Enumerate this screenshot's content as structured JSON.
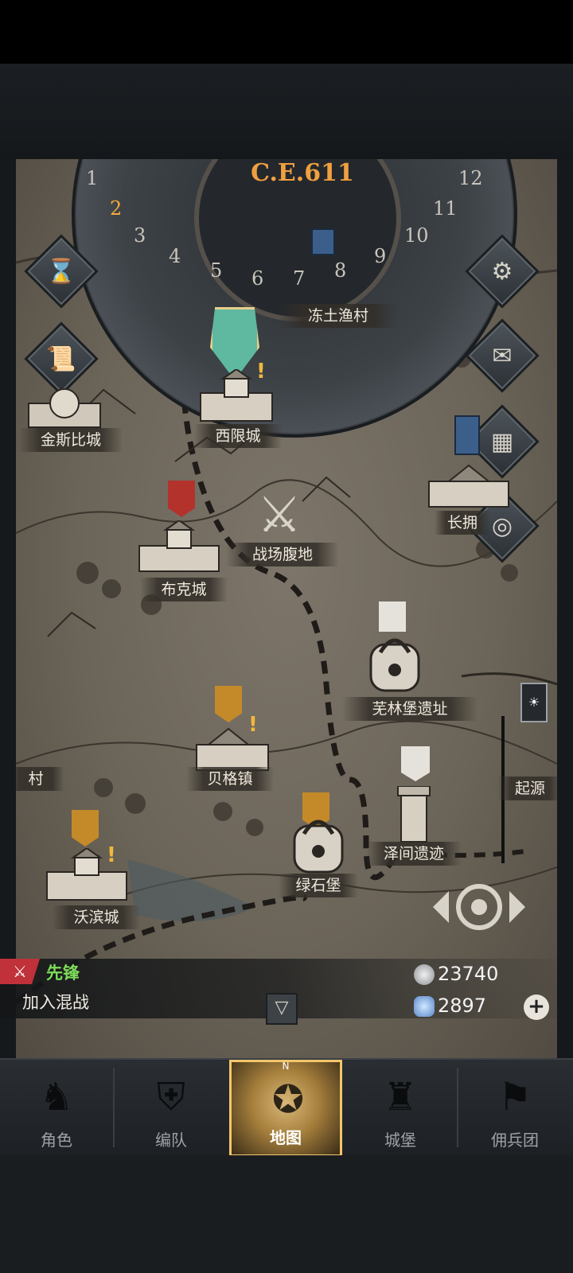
{
  "calendar": {
    "era": "C.E.611",
    "months": [
      "1",
      "2",
      "3",
      "4",
      "5",
      "6",
      "7",
      "8",
      "9",
      "10",
      "11",
      "12"
    ],
    "active_month": "2"
  },
  "locations": {
    "frozen_village": "冻土渔村",
    "xixian": "西限城",
    "jinsibi": "金斯比城",
    "changyong": "长拥",
    "battlefield": "战场腹地",
    "buke": "布克城",
    "wulin_ruins": "芜林堡遗址",
    "village_left": "村",
    "beige": "贝格镇",
    "qiyuan": "起源",
    "zejian_ruins": "泽间遗迹",
    "lvshi": "绿石堡",
    "wobin": "沃滨城"
  },
  "status": {
    "vanguard_tag": "⚔",
    "vanguard": "先锋",
    "join": "加入混战"
  },
  "resources": {
    "silver": "23740",
    "crystal": "2897",
    "add": "+"
  },
  "nav": [
    {
      "label": "角色",
      "icon": "knight-icon"
    },
    {
      "label": "编队",
      "icon": "helmet-icon"
    },
    {
      "label": "地图",
      "icon": "compass-map-icon",
      "compass_n": "N"
    },
    {
      "label": "城堡",
      "icon": "castle-icon"
    },
    {
      "label": "佣兵团",
      "icon": "mercenary-icon"
    }
  ],
  "colors": {
    "accent": "#f5a93d",
    "vanguard": "#7ddc5a",
    "vanguard_tag": "#c0313a"
  }
}
